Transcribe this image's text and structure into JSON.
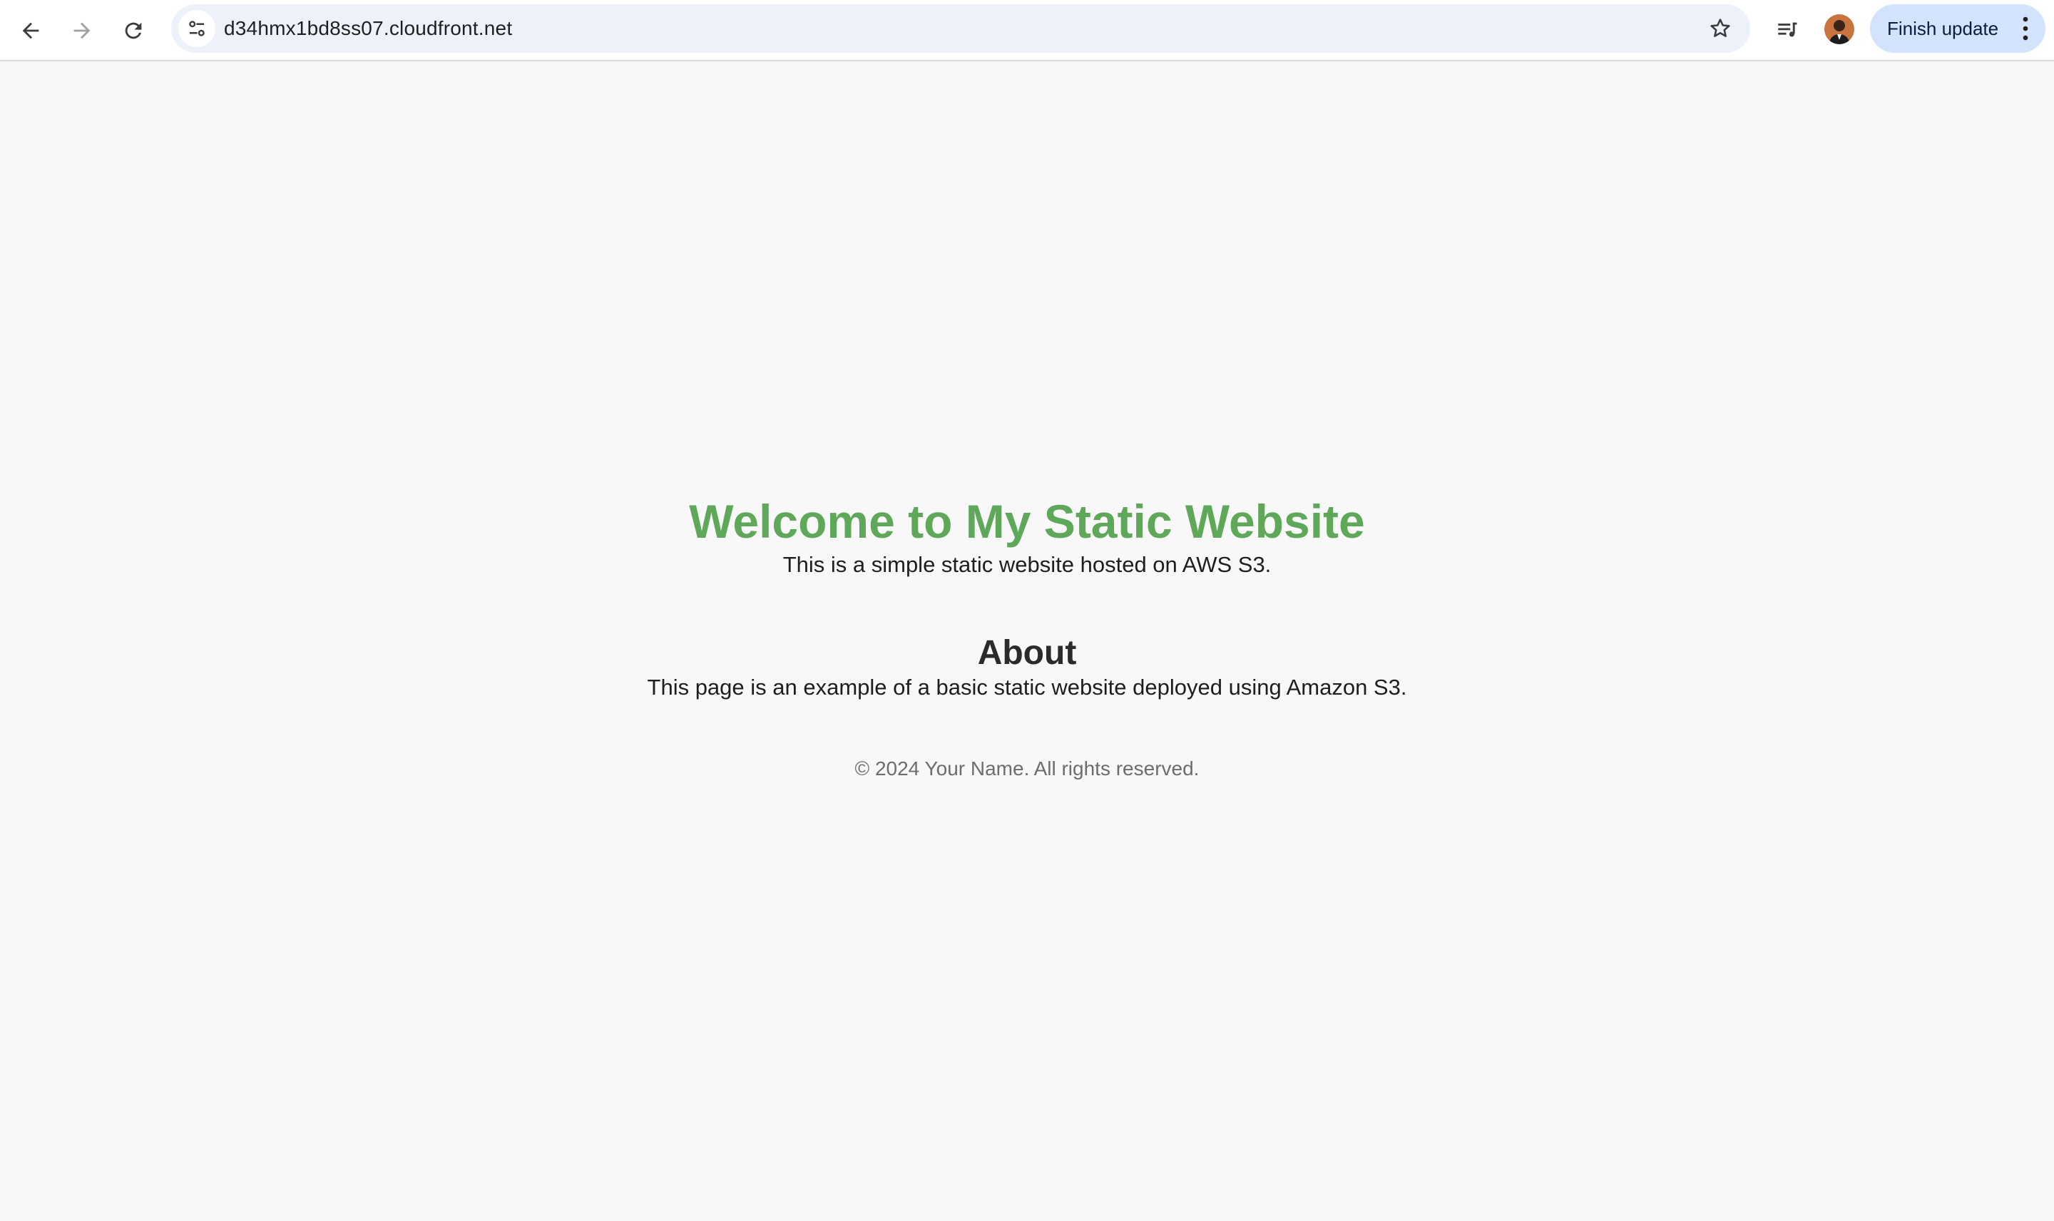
{
  "browser": {
    "url": "d34hmx1bd8ss07.cloudfront.net",
    "update_button_label": "Finish update"
  },
  "page": {
    "headline": "Welcome to My Static Website",
    "tagline": "This is a simple static website hosted on AWS S3.",
    "about": {
      "heading": "About",
      "text": "This page is an example of a basic static website deployed using Amazon S3."
    },
    "footer": "© 2024 Your Name. All rights reserved."
  },
  "colors": {
    "headline": "#5fa85a",
    "page_background": "#f8f8f8",
    "update_button": "#d3e3fd",
    "omnibox": "#edf2fa"
  },
  "icons": [
    "back-arrow-icon",
    "forward-arrow-icon",
    "reload-icon",
    "site-info-icon",
    "star-icon",
    "media-controls-icon",
    "avatar",
    "more-vert-icon"
  ]
}
